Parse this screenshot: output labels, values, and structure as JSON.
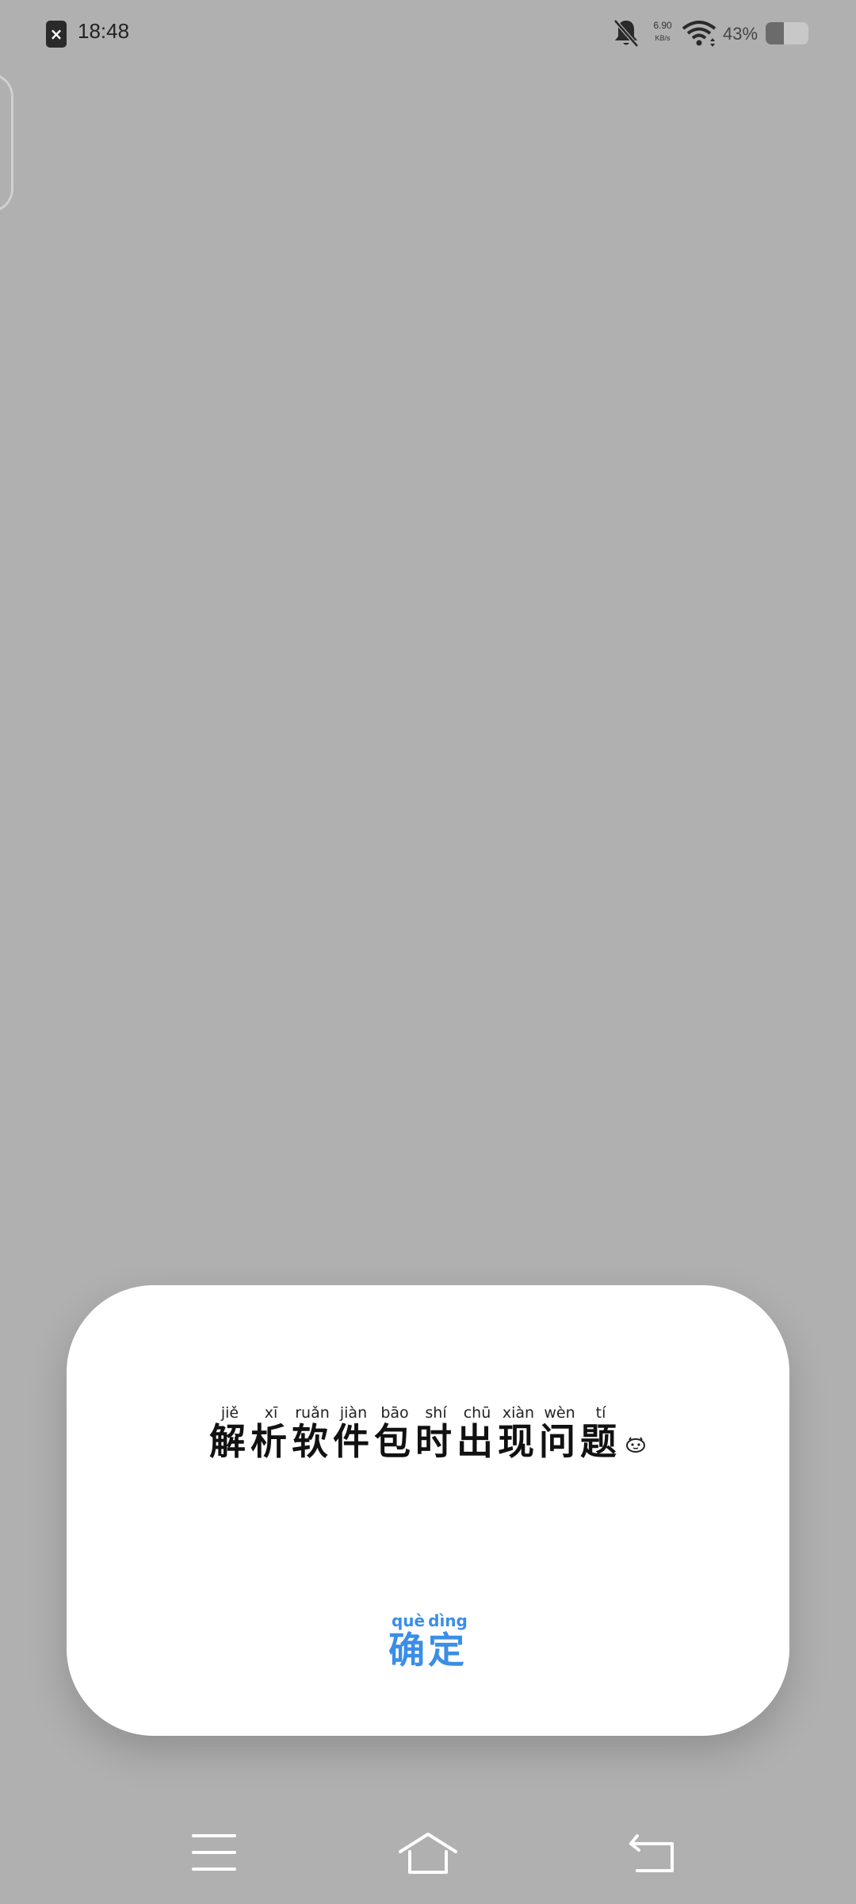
{
  "status_bar": {
    "time": "18:48",
    "net_speed_value": "6.90",
    "net_speed_unit": "KB/s",
    "battery_percent": "43%",
    "battery_level": 0.43,
    "icons": [
      "sim-error-icon",
      "bell-muted-icon",
      "wifi-icon",
      "battery-icon"
    ]
  },
  "dialog": {
    "message": [
      {
        "char": "解",
        "pinyin": "jiě"
      },
      {
        "char": "析",
        "pinyin": "xī"
      },
      {
        "char": "软",
        "pinyin": "ruǎn"
      },
      {
        "char": "件",
        "pinyin": "jiàn"
      },
      {
        "char": "包",
        "pinyin": "bāo"
      },
      {
        "char": "时",
        "pinyin": "shí"
      },
      {
        "char": "出",
        "pinyin": "chū"
      },
      {
        "char": "现",
        "pinyin": "xiàn"
      },
      {
        "char": "问",
        "pinyin": "wèn"
      },
      {
        "char": "题",
        "pinyin": "tí"
      }
    ],
    "message_icon": "emoji-icon",
    "confirm": [
      {
        "char": "确",
        "pinyin": "què"
      },
      {
        "char": "定",
        "pinyin": "dìng"
      }
    ],
    "confirm_color": "#3a8ee6"
  },
  "nav_bar": {
    "icons": [
      "menu-icon",
      "home-icon",
      "back-icon"
    ]
  }
}
